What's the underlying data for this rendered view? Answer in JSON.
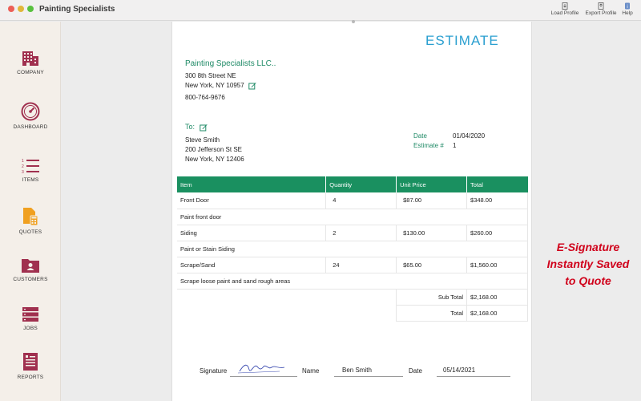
{
  "window": {
    "title": "Painting Specialists"
  },
  "toolbar": {
    "load_profile": "Load Profile",
    "export_profile": "Export Profile",
    "help": "Help"
  },
  "sidebar": {
    "items": [
      {
        "label": "COMPANY",
        "icon": "building-icon"
      },
      {
        "label": "DASHBOARD",
        "icon": "gauge-icon"
      },
      {
        "label": "ITEMS",
        "icon": "numbered-list-icon"
      },
      {
        "label": "QUOTES",
        "icon": "document-calculator-icon"
      },
      {
        "label": "CUSTOMERS",
        "icon": "folder-person-icon"
      },
      {
        "label": "JOBS",
        "icon": "stack-icon"
      },
      {
        "label": "REPORTS",
        "icon": "report-icon"
      }
    ]
  },
  "document": {
    "title": "ESTIMATE",
    "company": {
      "name": "Painting Specialists LLC..",
      "street": "300 8th Street NE",
      "city": "New York, NY 10957",
      "phone": "800-764-9676"
    },
    "to": {
      "label": "To:",
      "name": "Steve Smith",
      "street": "200 Jefferson St SE",
      "city": "New York, NY 12406"
    },
    "meta": {
      "date_label": "Date",
      "date_value": "01/04/2020",
      "estimate_label": "Estimate #",
      "estimate_value": "1"
    },
    "table": {
      "headers": {
        "item": "Item",
        "quantity": "Quantity",
        "unit_price": "Unit Price",
        "total": "Total"
      },
      "rows": [
        {
          "item": "Front Door",
          "quantity": "4",
          "unit_price": "$87.00",
          "total": "$348.00",
          "description": "Paint front door"
        },
        {
          "item": "Siding",
          "quantity": "2",
          "unit_price": "$130.00",
          "total": "$260.00",
          "description": "Paint or Stain Siding"
        },
        {
          "item": "Scrape/Sand",
          "quantity": "24",
          "unit_price": "$65.00",
          "total": "$1,560.00",
          "description": "Scrape loose paint and sand rough areas"
        }
      ],
      "subtotal_label": "Sub Total",
      "subtotal_value": "$2,168.00",
      "total_label": "Total",
      "total_value": "$2,168.00"
    },
    "signature": {
      "signature_label": "Signature",
      "name_label": "Name",
      "name_value": "Ben Smith",
      "date_label": "Date",
      "date_value": "05/14/2021"
    }
  },
  "promo": {
    "line1": "E-Signature",
    "line2": "Instantly Saved",
    "line3": "to Quote"
  },
  "colors": {
    "accent_green": "#1a9060",
    "title_blue": "#2a9fd0",
    "icon_maroon": "#a0304f",
    "icon_orange": "#f0a020",
    "promo_red": "#d0021b"
  }
}
